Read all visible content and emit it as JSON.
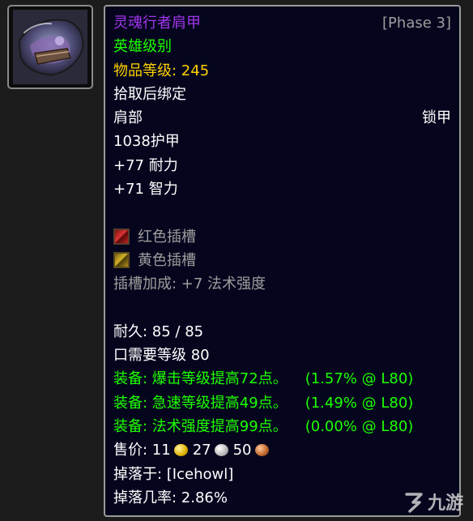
{
  "item": {
    "name": "灵魂行者肩甲",
    "phase": "[Phase 3]",
    "difficulty": "英雄级别",
    "item_level_label": "物品等级: ",
    "item_level_value": "245",
    "binding": "拾取后绑定",
    "slot": "肩部",
    "armor_type": "锁甲",
    "armor": "1038护甲",
    "stats": [
      "+77 耐力",
      "+71 智力"
    ],
    "sockets": [
      {
        "color": "red",
        "label": "红色插槽"
      },
      {
        "color": "yellow",
        "label": "黄色插槽"
      }
    ],
    "socket_bonus": "插槽加成: +7 法术强度",
    "durability": "耐久: 85 / 85",
    "required_level": "口需要等级 80",
    "equip_effects": [
      {
        "text": "装备: 爆击等级提高72点。",
        "pct": "(1.57% @ L80)"
      },
      {
        "text": "装备: 急速等级提高49点。",
        "pct": "(1.49% @ L80)"
      },
      {
        "text": "装备: 法术强度提高99点。",
        "pct": "(0.00% @ L80)"
      }
    ],
    "sell_price": {
      "label": "售价: ",
      "gold": "11",
      "silver": "27",
      "copper": "50"
    },
    "drop_from": "掉落于: [Icehowl]",
    "drop_rate": "掉落几率: 2.86%"
  },
  "watermark": "九游",
  "colors": {
    "epic": "#a335ee",
    "uncommon": "#1eff00",
    "gold": "#ffd100",
    "grey": "#9d9d9d",
    "background": "#05061e"
  },
  "icons": {
    "item_icon": "shoulder-armor-icon",
    "coins": [
      "gold-coin-icon",
      "silver-coin-icon",
      "copper-coin-icon"
    ]
  }
}
